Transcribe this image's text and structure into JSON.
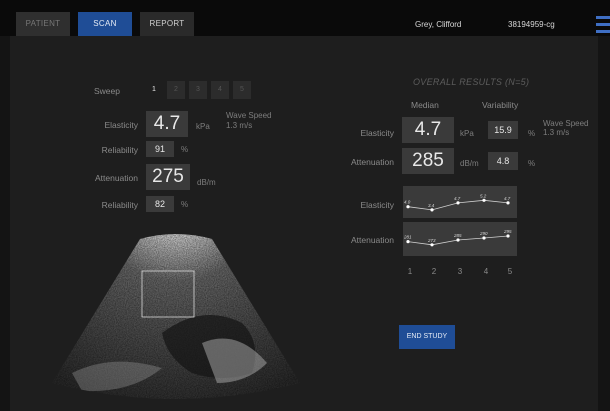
{
  "header": {
    "tabs": [
      "PATIENT",
      "SCAN",
      "REPORT"
    ],
    "active_tab": "SCAN",
    "patient_name": "Grey, Clifford",
    "patient_id": "38194959-cg",
    "accent_color": "#1f4d96"
  },
  "scan": {
    "sweep_label": "Sweep",
    "sweeps": [
      "1",
      "2",
      "3",
      "4",
      "5"
    ],
    "active_sweep": "1",
    "elasticity_label": "Elasticity",
    "elasticity_value": "4.7",
    "elasticity_unit": "kPa",
    "wave_speed_label": "Wave Speed",
    "wave_speed_value": "1.3 m/s",
    "reliability_label_1": "Reliability",
    "reliability_value_1": "91",
    "reliability_unit_1": "%",
    "attenuation_label": "Attenuation",
    "attenuation_value": "275",
    "attenuation_unit": "dB/m",
    "reliability_label_2": "Reliability",
    "reliability_value_2": "82",
    "reliability_unit_2": "%"
  },
  "results": {
    "title": "OVERALL RESULTS (N=5)",
    "median_header": "Median",
    "variability_header": "Variability",
    "elasticity_label": "Elasticity",
    "elasticity_median": "4.7",
    "elasticity_unit": "kPa",
    "elasticity_variability": "15.9",
    "elasticity_var_unit": "%",
    "wave_speed_label": "Wave Speed",
    "wave_speed_value": "1.3 m/s",
    "attenuation_label": "Attenuation",
    "attenuation_median": "285",
    "attenuation_unit": "dB/m",
    "attenuation_variability": "4.8",
    "attenuation_var_unit": "%",
    "trend_elasticity_label": "Elasticity",
    "trend_attenuation_label": "Attenuation",
    "trend_elasticity_values": [
      "4.0",
      "3.4",
      "4.7",
      "5.2",
      "4.7"
    ],
    "trend_attenuation_values": [
      "281",
      "273",
      "285",
      "290",
      "295"
    ],
    "x_labels": [
      "1",
      "2",
      "3",
      "4",
      "5"
    ],
    "end_study_label": "END STUDY"
  }
}
